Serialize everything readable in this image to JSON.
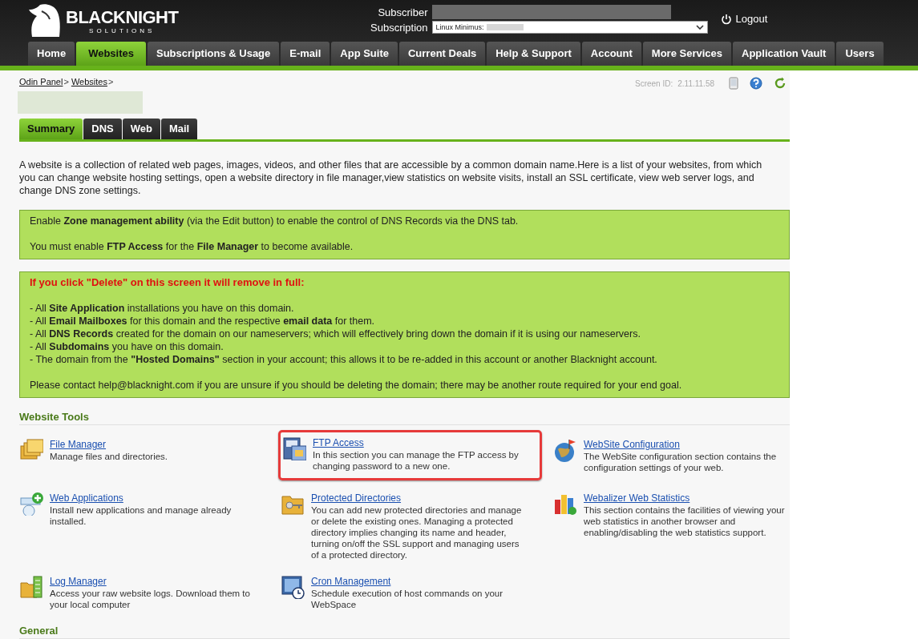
{
  "header": {
    "brand": "BLACKNIGHT",
    "brand_sub": "SOLUTIONS",
    "subscriber_label": "Subscriber",
    "subscription_label": "Subscription",
    "subscription_value": "Linux Minimus:",
    "logout": "Logout"
  },
  "nav": [
    {
      "label": "Home",
      "selected": false
    },
    {
      "label": "Websites",
      "selected": true
    },
    {
      "label": "Subscriptions & Usage",
      "selected": false
    },
    {
      "label": "E-mail",
      "selected": false
    },
    {
      "label": "App Suite",
      "selected": false
    },
    {
      "label": "Current Deals",
      "selected": false
    },
    {
      "label": "Help & Support",
      "selected": false
    },
    {
      "label": "Account",
      "selected": false
    },
    {
      "label": "More Services",
      "selected": false
    },
    {
      "label": "Application Vault",
      "selected": false
    },
    {
      "label": "Users",
      "selected": false
    }
  ],
  "breadcrumbs": [
    {
      "label": "Odin Panel",
      "separator": ">"
    },
    {
      "label": "Websites",
      "separator": ">"
    }
  ],
  "screen_id": {
    "label": "Screen ID:",
    "value": "2.11.11.58"
  },
  "tabs": [
    {
      "label": "Summary",
      "selected": true
    },
    {
      "label": "DNS",
      "selected": false
    },
    {
      "label": "Web",
      "selected": false
    },
    {
      "label": "Mail",
      "selected": false
    }
  ],
  "intro": "A website is a collection of related web pages, images, videos, and other files that are accessible by a common domain name.Here is a list of your websites, from which you can change website hosting settings, open a website directory in file manager,view statistics on website visits, install an SSL certificate, view web server logs, and change DNS zone settings.",
  "notices": [
    {
      "lines": [
        {
          "kind": "text",
          "text": "Enable **Zone management ability** (via the Edit button) to enable the control of DNS Records via the DNS tab."
        },
        {
          "kind": "gap"
        },
        {
          "kind": "text",
          "text": "You must enable **FTP Access** for the **File Manager** to become available."
        }
      ]
    },
    {
      "lines": [
        {
          "kind": "warning",
          "text": "If you click \"Delete\" on this screen it will remove in full:"
        },
        {
          "kind": "gap"
        },
        {
          "kind": "text",
          "text": "- All **Site Application** installations you have on this domain."
        },
        {
          "kind": "text",
          "text": "- All **Email Mailboxes** for this domain and the respective **email data** for them."
        },
        {
          "kind": "text",
          "text": "- All **DNS Records** created for the domain on our nameservers; which will effectively bring down the domain if it is using our nameservers."
        },
        {
          "kind": "text",
          "text": "- All **Subdomains** you have on this domain."
        },
        {
          "kind": "text",
          "text": "- The domain from the **\"Hosted Domains\"** section in your account; this allows it to be re-added in this account or another Blacknight account."
        },
        {
          "kind": "gap"
        },
        {
          "kind": "text",
          "text": "Please contact help@blacknight.com if you are unsure if you should be deleting the domain; there may be another route required for your end goal."
        }
      ]
    }
  ],
  "website_tools": {
    "title": "Website Tools",
    "items": [
      {
        "kind": "folders",
        "title": "File Manager",
        "description": "Manage files and directories.",
        "highlighted": false
      },
      {
        "kind": "ftp",
        "title": "FTP Access",
        "description": "In this section you can manage the FTP access by changing password to a new one.",
        "highlighted": true
      },
      {
        "kind": "globe",
        "title": "WebSite Configuration",
        "description": "The WebSite configuration section contains the configuration settings of your web.",
        "highlighted": false
      },
      {
        "kind": "apps",
        "title": "Web Applications",
        "description": "Install new applications and manage already installed.",
        "highlighted": false
      },
      {
        "kind": "key",
        "title": "Protected Directories",
        "description": "You can add new protected directories and manage or delete the existing ones. Managing a protected directory implies changing its name and header, turning on/off the SSL support and managing users of a protected directory.",
        "highlighted": false
      },
      {
        "kind": "stats",
        "title": "Webalizer Web Statistics",
        "description": "This section contains the facilities of viewing your web statistics in another browser and enabling/disabling the web statistics support.",
        "highlighted": false
      },
      {
        "kind": "logs",
        "title": "Log Manager",
        "description": "Access your raw website logs. Download them to your local computer",
        "highlighted": false
      },
      {
        "kind": "cron",
        "title": "Cron Management",
        "description": "Schedule execution of host commands on your WebSpace",
        "highlighted": false
      }
    ]
  },
  "general": {
    "title": "General"
  }
}
